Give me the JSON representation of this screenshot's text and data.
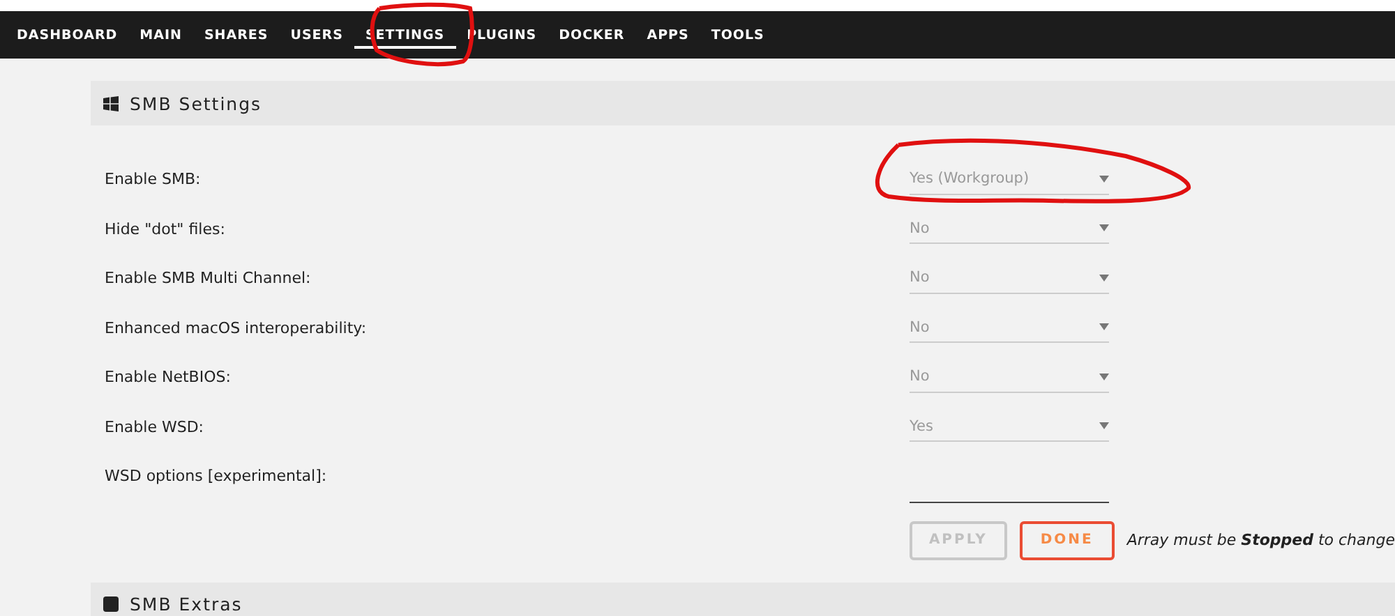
{
  "nav": [
    {
      "label": "DASHBOARD",
      "selected": false
    },
    {
      "label": "MAIN",
      "selected": false
    },
    {
      "label": "SHARES",
      "selected": false
    },
    {
      "label": "USERS",
      "selected": false
    },
    {
      "label": "SETTINGS",
      "selected": true
    },
    {
      "label": "PLUGINS",
      "selected": false
    },
    {
      "label": "DOCKER",
      "selected": false
    },
    {
      "label": "APPS",
      "selected": false
    },
    {
      "label": "TOOLS",
      "selected": false
    }
  ],
  "section": {
    "title": "SMB Settings"
  },
  "settings": [
    {
      "kind": "select",
      "label": "Enable SMB:",
      "value": "Yes (Workgroup)"
    },
    {
      "kind": "select",
      "label": "Hide \"dot\" files:",
      "value": "No"
    },
    {
      "kind": "select",
      "label": "Enable SMB Multi Channel:",
      "value": "No"
    },
    {
      "kind": "select",
      "label": "Enhanced macOS interoperability:",
      "value": "No"
    },
    {
      "kind": "select",
      "label": "Enable NetBIOS:",
      "value": "No"
    },
    {
      "kind": "select",
      "label": "Enable WSD:",
      "value": "Yes"
    },
    {
      "kind": "text",
      "label": "WSD options [experimental]:"
    }
  ],
  "buttons": [
    {
      "label": "APPLY",
      "disabled": true
    },
    {
      "label": "DONE",
      "disabled": false
    }
  ],
  "note": "Array must be **Stopped** to change",
  "next_section": {
    "title": "SMB Extras"
  }
}
